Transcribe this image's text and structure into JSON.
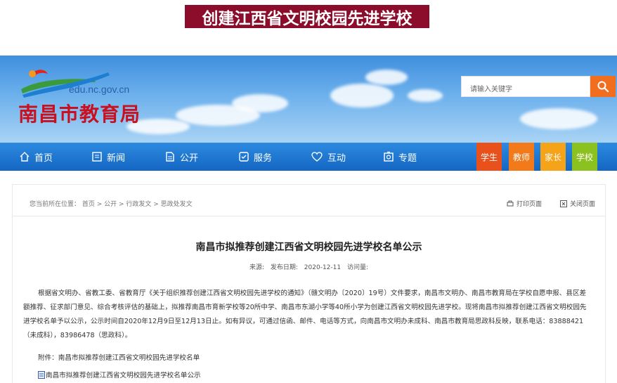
{
  "banner": {
    "title": "创建江西省文明校园先进学校"
  },
  "header": {
    "domain": "edu.nc.gov.cn",
    "site_name": "南昌市教育局",
    "search_placeholder": "请输入关键字"
  },
  "nav": {
    "items": [
      {
        "label": "首页",
        "icon": "home-icon"
      },
      {
        "label": "新闻",
        "icon": "news-icon"
      },
      {
        "label": "公开",
        "icon": "document-icon"
      },
      {
        "label": "服务",
        "icon": "service-icon"
      },
      {
        "label": "互动",
        "icon": "heart-icon"
      },
      {
        "label": "专题",
        "icon": "topic-icon"
      }
    ],
    "roles": [
      {
        "label": "学生",
        "color": "#e8501c"
      },
      {
        "label": "教师",
        "color": "#f27a1a"
      },
      {
        "label": "家长",
        "color": "#f5a318"
      },
      {
        "label": "学校",
        "color": "#8cc21f"
      }
    ]
  },
  "content": {
    "breadcrumb": "您当前所在位置：  首页 > 公开 > 行政发文 > 思政处发文",
    "print_label": "打印页面",
    "close_label": "关闭页面",
    "title": "南昌市拟推荐创建江西省文明校园先进学校名单公示",
    "meta": {
      "source": "来源:",
      "date_label": "发布日期:",
      "date": "2020-12-11",
      "views_label": "访问量:"
    },
    "body": "根据省文明办、省教工委、省教育厅《关于组织推荐创建江西省文明校园先进学校的通知》（赣文明办〔2020〕19号）文件要求，南昌市文明办、南昌市教育局在学校自愿申报、县区差额推荐、征求部门意见、综合考核评估的基础上，拟推荐南昌市育新学校等20所中学、南昌市东湖小学等40所小学为创建江西省文明校园先进学校。现将南昌市拟推荐创建江西省文明校园先进学校名单予以公示，公示时间自2020年12月9日至12月13日止。如有异议，可通过信函、邮件、电话等方式，向南昌市文明办未成科、南昌市教育局思政科反映，联系电话：83888421（未成科），83986478（思政科）。",
    "attachment_label": "附件：南昌市拟推荐创建江西省文明校园先进学校名单",
    "attachment_link": "南昌市拟推荐创建江西省文明校园先进学校名单公示"
  },
  "colors": {
    "banner": "#8b0d2b",
    "nav": "#1466c2",
    "search_button": "#f06e1e",
    "site_name": "#c8101f"
  }
}
